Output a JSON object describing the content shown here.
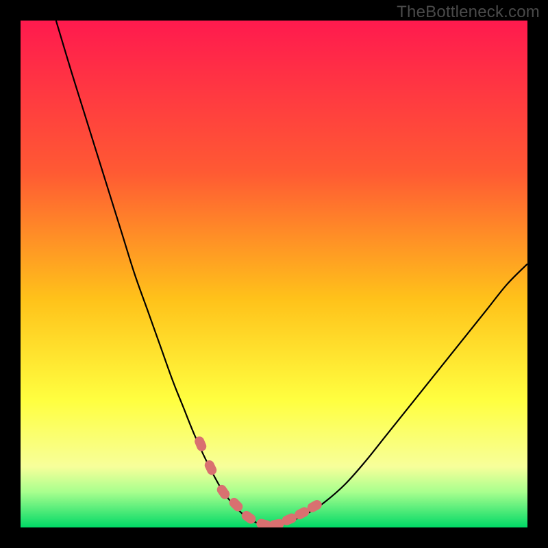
{
  "watermark": "TheBottleneck.com",
  "colors": {
    "bg_black": "#000000",
    "grad_top": "#ff1a4e",
    "grad_mid1": "#ff6a2a",
    "grad_mid2": "#ffd21a",
    "grad_low": "#ffff52",
    "grad_bottom1": "#c9ff7a",
    "grad_bottom2": "#00e676",
    "curve": "#000000",
    "marker_fill": "#d97070",
    "marker_stroke": "#b35a5a",
    "watermark": "#4a4a4a"
  },
  "chart_data": {
    "type": "line",
    "title": "",
    "xlabel": "",
    "ylabel": "",
    "xlim": [
      0,
      100
    ],
    "ylim": [
      0,
      100
    ],
    "gradient_stops": [
      {
        "offset": 0.0,
        "color": "#ff1a4e"
      },
      {
        "offset": 0.3,
        "color": "#ff5a33"
      },
      {
        "offset": 0.55,
        "color": "#ffc21a"
      },
      {
        "offset": 0.75,
        "color": "#ffff40"
      },
      {
        "offset": 0.88,
        "color": "#f7ff9a"
      },
      {
        "offset": 0.93,
        "color": "#a8ff8e"
      },
      {
        "offset": 1.0,
        "color": "#00d966"
      }
    ],
    "series": [
      {
        "name": "bottleneck-curve",
        "x": [
          7,
          10,
          12.5,
          15,
          17.5,
          20,
          22.5,
          25,
          27.5,
          30,
          32,
          34,
          36,
          38,
          40,
          42,
          44,
          46,
          48,
          51,
          54,
          57,
          60,
          64,
          68,
          72,
          76,
          80,
          84,
          88,
          92,
          96,
          100
        ],
        "y": [
          100,
          90,
          82,
          74,
          66,
          58,
          50,
          43,
          36,
          29,
          24,
          19,
          14.5,
          10.5,
          7,
          4.5,
          2.5,
          1.2,
          0.5,
          0.5,
          1.5,
          3,
          5,
          8.5,
          13,
          18,
          23,
          28,
          33,
          38,
          43,
          48,
          52
        ]
      }
    ],
    "markers": {
      "name": "highlight-points",
      "x": [
        35.5,
        37.5,
        40,
        42.5,
        45,
        48,
        50.5,
        53,
        55.5,
        58
      ],
      "y": [
        16.5,
        11.8,
        7.0,
        4.5,
        2.0,
        0.6,
        0.6,
        1.6,
        2.8,
        4.2
      ]
    }
  }
}
